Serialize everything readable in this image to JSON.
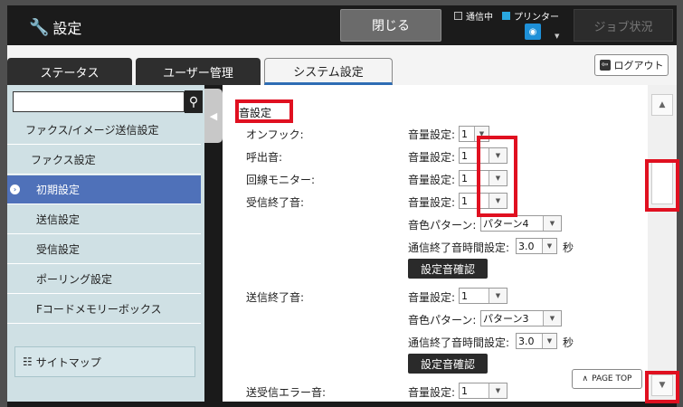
{
  "header": {
    "title": "設定",
    "close_label": "閉じる",
    "comm_label": "通信中",
    "printer_label": "プリンター",
    "job_label": "ジョブ状況",
    "wrench_icon": "wrench-icon",
    "wifi_icon": "wifi-icon"
  },
  "tabs": [
    {
      "label": "ステータス"
    },
    {
      "label": "ユーザー管理"
    },
    {
      "label": "システム設定"
    }
  ],
  "logout_label": "ログアウト",
  "sidebar": {
    "search_value": "",
    "items": [
      {
        "label": "ファクス/イメージ送信設定"
      },
      {
        "label": "ファクス設定"
      },
      {
        "label": "初期設定"
      },
      {
        "label": "送信設定"
      },
      {
        "label": "受信設定"
      },
      {
        "label": "ポーリング設定"
      },
      {
        "label": "Fコードメモリーボックス"
      }
    ],
    "sitemap_label": "サイトマップ"
  },
  "content": {
    "section_title": "音設定",
    "rows": {
      "onhook": {
        "label": "オンフック:",
        "vol_label": "音量設定:",
        "vol_value": "1"
      },
      "ring": {
        "label": "呼出音:",
        "vol_label": "音量設定:",
        "vol_value": "1"
      },
      "monitor": {
        "label": "回線モニター:",
        "vol_label": "音量設定:",
        "vol_value": "1"
      },
      "recv_end": {
        "label": "受信終了音:",
        "vol_label": "音量設定:",
        "vol_value": "1",
        "pattern_label": "音色パターン:",
        "pattern_value": "パターン4",
        "time_label": "通信終了音時間設定:",
        "time_value": "3.0",
        "time_unit": "秒",
        "confirm_label": "設定音確認"
      },
      "send_end": {
        "label": "送信終了音:",
        "vol_label": "音量設定:",
        "vol_value": "1",
        "pattern_label": "音色パターン:",
        "pattern_value": "パターン3",
        "time_label": "通信終了音時間設定:",
        "time_value": "3.0",
        "time_unit": "秒",
        "confirm_label": "設定音確認"
      },
      "err": {
        "label": "送受信エラー音:",
        "vol_label": "音量設定:",
        "vol_value": "1"
      }
    },
    "pagetop_label": "PAGE TOP"
  },
  "colors": {
    "highlight": "#e01020",
    "active_sidebar": "#4f71b9",
    "sidebar_bg": "#cfe0e4",
    "header_bg": "#1b1b1b"
  }
}
